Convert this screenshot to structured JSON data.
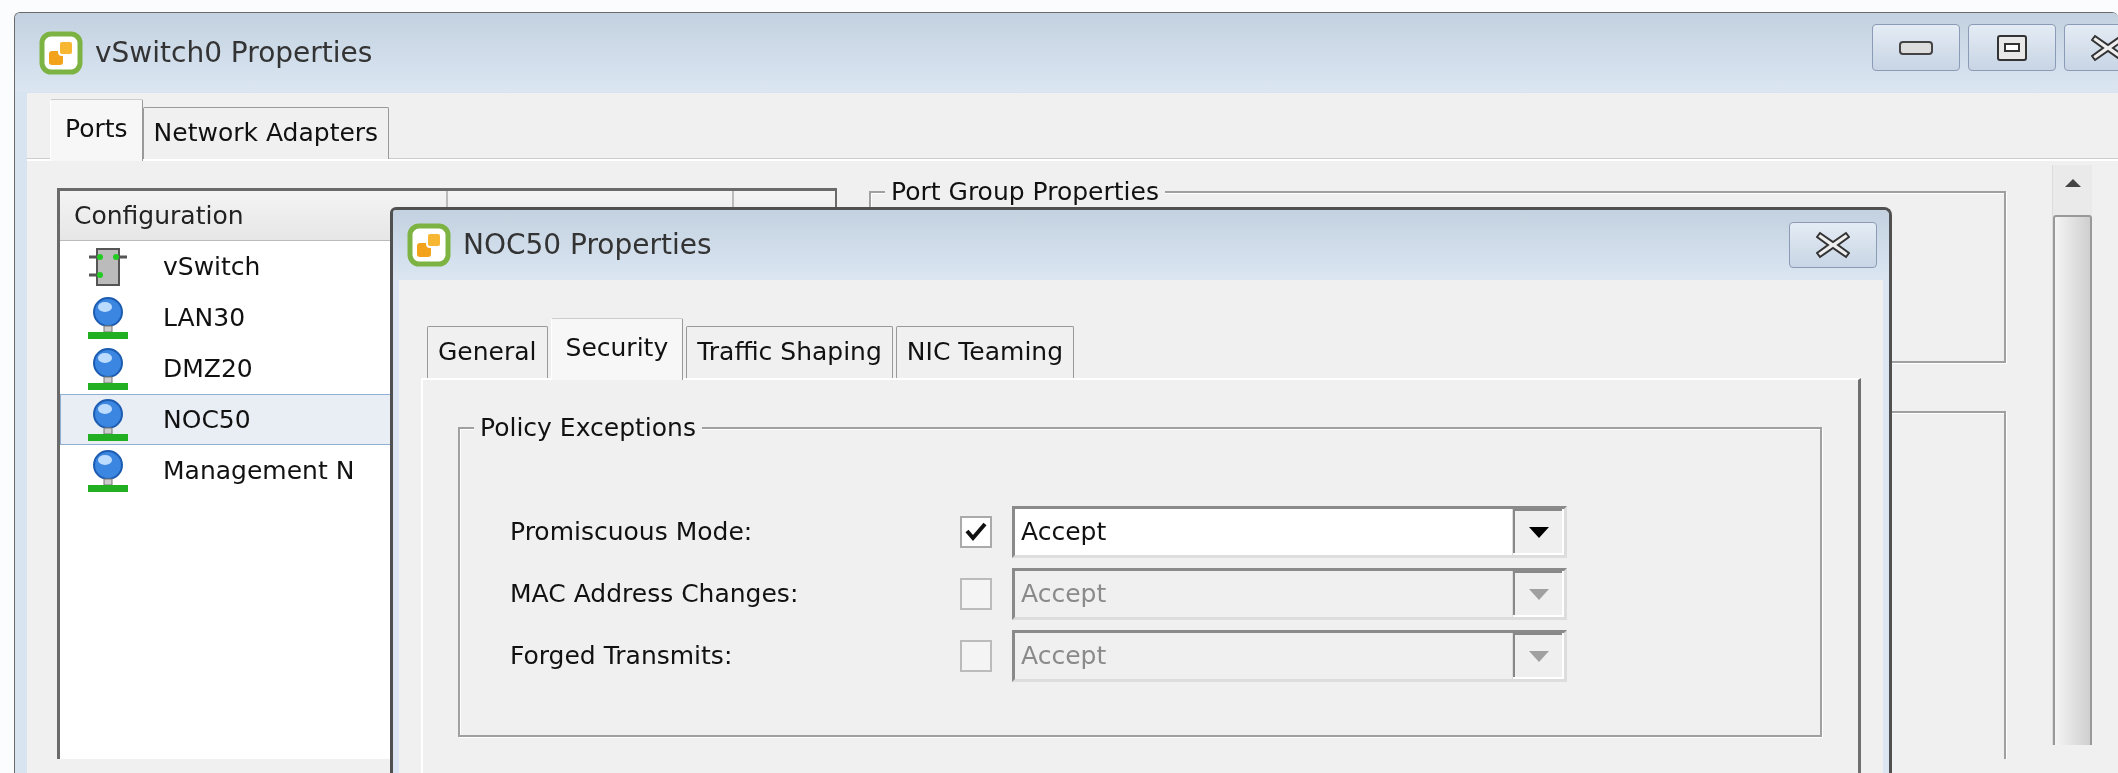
{
  "window": {
    "title": "vSwitch0 Properties"
  },
  "tabs": [
    {
      "label": "Ports",
      "selected": true
    },
    {
      "label": "Network Adapters",
      "selected": false
    }
  ],
  "config_list": {
    "columns": [
      "Configuration"
    ],
    "rows": [
      {
        "label": "vSwitch",
        "kind": "switch",
        "selected": false
      },
      {
        "label": "LAN30",
        "kind": "port_group",
        "selected": false
      },
      {
        "label": "DMZ20",
        "kind": "port_group",
        "selected": false
      },
      {
        "label": "NOC50",
        "kind": "port_group",
        "selected": true
      },
      {
        "label": "Management N",
        "kind": "port_group",
        "selected": false
      }
    ]
  },
  "port_group_properties": {
    "title": "Port Group Properties"
  },
  "dialog": {
    "title": "NOC50 Properties",
    "tabs": [
      {
        "label": "General",
        "selected": false
      },
      {
        "label": "Security",
        "selected": true
      },
      {
        "label": "Traffic Shaping",
        "selected": false
      },
      {
        "label": "NIC Teaming",
        "selected": false
      }
    ],
    "policy_exceptions": {
      "title": "Policy Exceptions",
      "rows": [
        {
          "label": "Promiscuous Mode:",
          "checked": true,
          "value": "Accept",
          "disabled": false
        },
        {
          "label": "MAC Address Changes:",
          "checked": false,
          "value": "Accept",
          "disabled": true
        },
        {
          "label": "Forged Transmits:",
          "checked": false,
          "value": "Accept",
          "disabled": true
        }
      ]
    }
  }
}
